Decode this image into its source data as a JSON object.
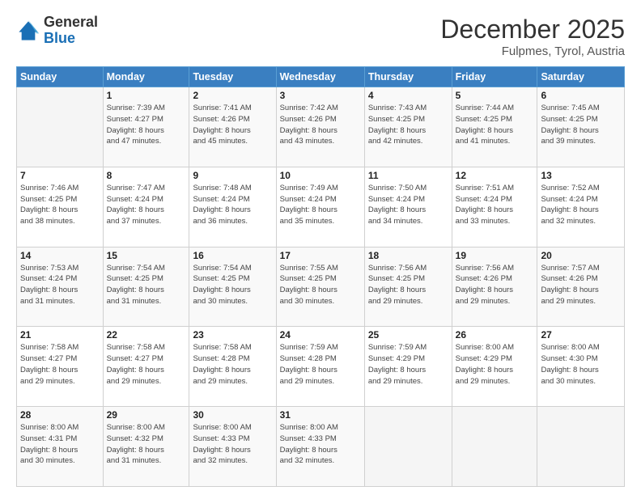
{
  "header": {
    "logo_general": "General",
    "logo_blue": "Blue",
    "month": "December 2025",
    "location": "Fulpmes, Tyrol, Austria"
  },
  "weekdays": [
    "Sunday",
    "Monday",
    "Tuesday",
    "Wednesday",
    "Thursday",
    "Friday",
    "Saturday"
  ],
  "weeks": [
    [
      {
        "day": "",
        "info": ""
      },
      {
        "day": "1",
        "info": "Sunrise: 7:39 AM\nSunset: 4:27 PM\nDaylight: 8 hours\nand 47 minutes."
      },
      {
        "day": "2",
        "info": "Sunrise: 7:41 AM\nSunset: 4:26 PM\nDaylight: 8 hours\nand 45 minutes."
      },
      {
        "day": "3",
        "info": "Sunrise: 7:42 AM\nSunset: 4:26 PM\nDaylight: 8 hours\nand 43 minutes."
      },
      {
        "day": "4",
        "info": "Sunrise: 7:43 AM\nSunset: 4:25 PM\nDaylight: 8 hours\nand 42 minutes."
      },
      {
        "day": "5",
        "info": "Sunrise: 7:44 AM\nSunset: 4:25 PM\nDaylight: 8 hours\nand 41 minutes."
      },
      {
        "day": "6",
        "info": "Sunrise: 7:45 AM\nSunset: 4:25 PM\nDaylight: 8 hours\nand 39 minutes."
      }
    ],
    [
      {
        "day": "7",
        "info": "Sunrise: 7:46 AM\nSunset: 4:25 PM\nDaylight: 8 hours\nand 38 minutes."
      },
      {
        "day": "8",
        "info": "Sunrise: 7:47 AM\nSunset: 4:24 PM\nDaylight: 8 hours\nand 37 minutes."
      },
      {
        "day": "9",
        "info": "Sunrise: 7:48 AM\nSunset: 4:24 PM\nDaylight: 8 hours\nand 36 minutes."
      },
      {
        "day": "10",
        "info": "Sunrise: 7:49 AM\nSunset: 4:24 PM\nDaylight: 8 hours\nand 35 minutes."
      },
      {
        "day": "11",
        "info": "Sunrise: 7:50 AM\nSunset: 4:24 PM\nDaylight: 8 hours\nand 34 minutes."
      },
      {
        "day": "12",
        "info": "Sunrise: 7:51 AM\nSunset: 4:24 PM\nDaylight: 8 hours\nand 33 minutes."
      },
      {
        "day": "13",
        "info": "Sunrise: 7:52 AM\nSunset: 4:24 PM\nDaylight: 8 hours\nand 32 minutes."
      }
    ],
    [
      {
        "day": "14",
        "info": "Sunrise: 7:53 AM\nSunset: 4:24 PM\nDaylight: 8 hours\nand 31 minutes."
      },
      {
        "day": "15",
        "info": "Sunrise: 7:54 AM\nSunset: 4:25 PM\nDaylight: 8 hours\nand 31 minutes."
      },
      {
        "day": "16",
        "info": "Sunrise: 7:54 AM\nSunset: 4:25 PM\nDaylight: 8 hours\nand 30 minutes."
      },
      {
        "day": "17",
        "info": "Sunrise: 7:55 AM\nSunset: 4:25 PM\nDaylight: 8 hours\nand 30 minutes."
      },
      {
        "day": "18",
        "info": "Sunrise: 7:56 AM\nSunset: 4:25 PM\nDaylight: 8 hours\nand 29 minutes."
      },
      {
        "day": "19",
        "info": "Sunrise: 7:56 AM\nSunset: 4:26 PM\nDaylight: 8 hours\nand 29 minutes."
      },
      {
        "day": "20",
        "info": "Sunrise: 7:57 AM\nSunset: 4:26 PM\nDaylight: 8 hours\nand 29 minutes."
      }
    ],
    [
      {
        "day": "21",
        "info": "Sunrise: 7:58 AM\nSunset: 4:27 PM\nDaylight: 8 hours\nand 29 minutes."
      },
      {
        "day": "22",
        "info": "Sunrise: 7:58 AM\nSunset: 4:27 PM\nDaylight: 8 hours\nand 29 minutes."
      },
      {
        "day": "23",
        "info": "Sunrise: 7:58 AM\nSunset: 4:28 PM\nDaylight: 8 hours\nand 29 minutes."
      },
      {
        "day": "24",
        "info": "Sunrise: 7:59 AM\nSunset: 4:28 PM\nDaylight: 8 hours\nand 29 minutes."
      },
      {
        "day": "25",
        "info": "Sunrise: 7:59 AM\nSunset: 4:29 PM\nDaylight: 8 hours\nand 29 minutes."
      },
      {
        "day": "26",
        "info": "Sunrise: 8:00 AM\nSunset: 4:29 PM\nDaylight: 8 hours\nand 29 minutes."
      },
      {
        "day": "27",
        "info": "Sunrise: 8:00 AM\nSunset: 4:30 PM\nDaylight: 8 hours\nand 30 minutes."
      }
    ],
    [
      {
        "day": "28",
        "info": "Sunrise: 8:00 AM\nSunset: 4:31 PM\nDaylight: 8 hours\nand 30 minutes."
      },
      {
        "day": "29",
        "info": "Sunrise: 8:00 AM\nSunset: 4:32 PM\nDaylight: 8 hours\nand 31 minutes."
      },
      {
        "day": "30",
        "info": "Sunrise: 8:00 AM\nSunset: 4:33 PM\nDaylight: 8 hours\nand 32 minutes."
      },
      {
        "day": "31",
        "info": "Sunrise: 8:00 AM\nSunset: 4:33 PM\nDaylight: 8 hours\nand 32 minutes."
      },
      {
        "day": "",
        "info": ""
      },
      {
        "day": "",
        "info": ""
      },
      {
        "day": "",
        "info": ""
      }
    ]
  ]
}
